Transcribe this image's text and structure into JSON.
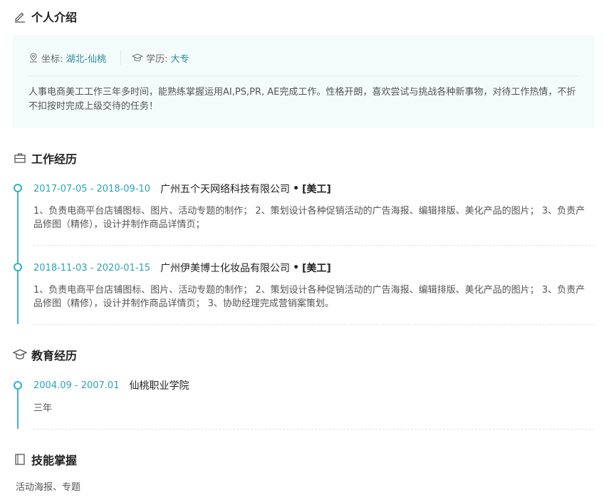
{
  "intro": {
    "title": "个人介绍",
    "location_key": "坐标:",
    "location_value": "湖北-仙桃",
    "education_key": "学历:",
    "education_value": "大专",
    "text": "人事电商美工工作三年多时间，能熟练掌握运用AI,PS,PR, AE完成工作。性格开朗，喜欢尝试与挑战各种新事物，对待工作热情，不折不扣按时完成上级交待的任务！"
  },
  "work": {
    "title": "工作经历",
    "items": [
      {
        "date": "2017-07-05 - 2018-09-10",
        "company": "广州五个天网络科技有限公司",
        "sep": "•",
        "role": "[美工]",
        "desc": "1、负责电商平台店铺图标、图片、活动专题的制作； 2、策划设计各种促销活动的广告海报、编辑排版、美化产品的图片； 3、负责产品修图（精修），设计并制作商品详情页；"
      },
      {
        "date": "2018-11-03 - 2020-01-15",
        "company": "广州伊美博士化妆品有限公司",
        "sep": "•",
        "role": "[美工]",
        "desc": "1、负责电商平台店铺图标、图片、活动专题的制作； 2、策划设计各种促销活动的广告海报、编辑排版、美化产品的图片； 3、负责产品修图（精修），设计并制作商品详情页； 3、协助经理完成营销案策划。"
      }
    ]
  },
  "education": {
    "title": "教育经历",
    "items": [
      {
        "date": "2004.09 - 2007.01",
        "school": "仙桃职业学院",
        "desc": "三年"
      }
    ]
  },
  "skills": {
    "title": "技能掌握",
    "text": "活动海报、专题"
  }
}
